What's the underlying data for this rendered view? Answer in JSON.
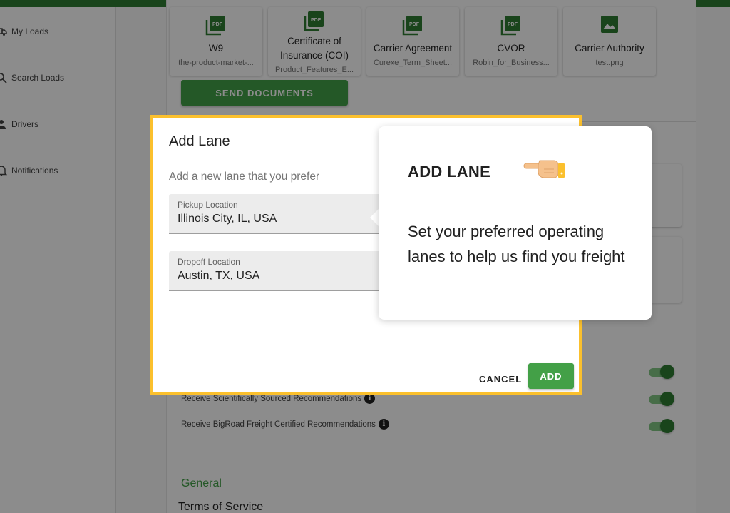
{
  "sidebar": {
    "items": [
      {
        "label": "My Loads",
        "icon": "truck-icon"
      },
      {
        "label": "Search Loads",
        "icon": "search-icon"
      },
      {
        "label": "Drivers",
        "icon": "person-icon"
      },
      {
        "label": "Notifications",
        "icon": "bell-icon"
      }
    ]
  },
  "documents": {
    "items": [
      {
        "title": "W9",
        "file": "the-product-market-...",
        "icon": "pdf-icon"
      },
      {
        "title": "Certificate of Insurance (COI)",
        "title_line1": "Certificate of",
        "title_line2": "Insurance (COI)",
        "file": "Product_Features_E...",
        "icon": "pdf-icon"
      },
      {
        "title": "Carrier Agreement",
        "file": "Curexe_Term_Sheet...",
        "icon": "pdf-icon"
      },
      {
        "title": "CVOR",
        "file": "Robin_for_Business...",
        "icon": "pdf-icon"
      },
      {
        "title": "Carrier Authority",
        "file": "test.png",
        "icon": "image-icon"
      }
    ],
    "send_label": "SEND DOCUMENTS"
  },
  "preferences": {
    "rows": [
      {
        "label": "Receive Scientifically Sourced Recommendations",
        "enabled": true
      },
      {
        "label": "Receive BigRoad Freight Certified Recommendations",
        "enabled": true
      }
    ],
    "extra_toggle_enabled": true
  },
  "general": {
    "title": "General",
    "tos_label": "Terms of Service"
  },
  "dialog": {
    "title": "Add Lane",
    "subtitle": "Add a new lane that you prefer",
    "pickup": {
      "label": "Pickup Location",
      "value": "Illinois City, IL, USA"
    },
    "dropoff": {
      "label": "Dropoff Location",
      "value": "Austin, TX, USA"
    },
    "cancel_label": "CANCEL",
    "add_label": "ADD"
  },
  "tooltip": {
    "title": "ADD LANE",
    "body": "Set your preferred operating lanes to help us find you freight",
    "icon": "pointing-hand-icon"
  },
  "colors": {
    "brand_green": "#43a047",
    "dark_green": "#2e7d32",
    "highlight": "#fbc02d"
  }
}
